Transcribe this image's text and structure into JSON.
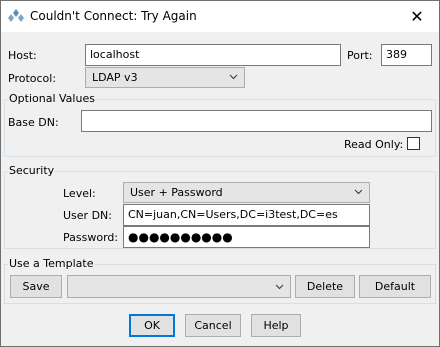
{
  "window": {
    "title": "Couldn't Connect: Try Again",
    "close_glyph": "✕"
  },
  "connection": {
    "host_label": "Host:",
    "host_value": "localhost",
    "port_label": "Port:",
    "port_value": "389",
    "protocol_label": "Protocol:",
    "protocol_value": "LDAP v3"
  },
  "optional": {
    "group_title": "Optional Values",
    "base_dn_label": "Base DN:",
    "base_dn_value": "",
    "read_only_label": "Read Only:",
    "read_only_checked": false
  },
  "security": {
    "group_title": "Security",
    "level_label": "Level:",
    "level_value": "User + Password",
    "user_dn_label": "User DN:",
    "user_dn_value": "CN=juan,CN=Users,DC=i3test,DC=es",
    "password_label": "Password:",
    "password_mask": "●●●●●●●●●●"
  },
  "template": {
    "group_title": "Use a Template",
    "save_label": "Save",
    "template_value": "",
    "delete_label": "Delete",
    "default_label": "Default"
  },
  "footer": {
    "ok_label": "OK",
    "cancel_label": "Cancel",
    "help_label": "Help"
  }
}
